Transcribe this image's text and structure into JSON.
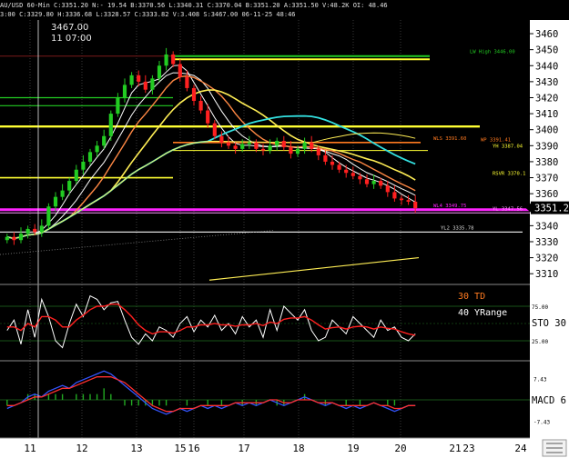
{
  "header": {
    "line1": "AU/USD 60-Min C:3351.20 N:- 19.54 B:3370.56 L:3340.31 C:3370.04 B:3351.20 A:3351.50 V:48.2K OI: 48.46",
    "line2": "3:00 C:3329.80 H:3336.68 L:3328.57 C:3333.82 V:3.408 S:3467.00 06-11-25 48:46"
  },
  "crosshair": {
    "price": "3467.00",
    "time": "11 07:00"
  },
  "colors": {
    "background": "#000000",
    "axis_bg": "#ffffff",
    "price_line": "#ff2020",
    "candle_up": "#22cc22",
    "candle_down": "#ff2020",
    "level_green": "#22cc22",
    "level_yellow": "#ffff33",
    "level_orange": "#ff7a20",
    "level_magenta": "#ff22ff",
    "ma_white": "#ffffff",
    "ma_cyan": "#33e0e0",
    "ma_yellow": "#ffee55",
    "ma_orange": "#ff8844",
    "stoch_white": "#ffffff",
    "stoch_red": "#ff2020",
    "macd_blue": "#3355ff",
    "macd_red": "#ff3030",
    "hist": "#22aa22",
    "divider": "#606060"
  },
  "chart_data": [
    {
      "panel": "price",
      "type": "candlestick",
      "x_labels": [
        "11",
        "12",
        "13",
        "15",
        "16",
        "17",
        "18",
        "19",
        "20",
        "21",
        "23",
        "24"
      ],
      "y_ticks": [
        3310,
        3320,
        3330,
        3340,
        3350,
        3360,
        3370,
        3380,
        3390,
        3400,
        3410,
        3420,
        3430,
        3440,
        3450,
        3460
      ],
      "ylim": [
        3305,
        3464
      ],
      "last_price": "3351.20",
      "closes": [
        3333,
        3331,
        3335,
        3338,
        3336,
        3340,
        3352,
        3358,
        3362,
        3368,
        3375,
        3380,
        3386,
        3390,
        3396,
        3410,
        3420,
        3428,
        3434,
        3430,
        3425,
        3432,
        3440,
        3447,
        3441,
        3433,
        3426,
        3418,
        3412,
        3404,
        3396,
        3392,
        3390,
        3388,
        3391,
        3392,
        3388,
        3387,
        3390,
        3393,
        3389,
        3385,
        3388,
        3392,
        3388,
        3384,
        3380,
        3378,
        3375,
        3373,
        3371,
        3369,
        3366,
        3368,
        3365,
        3361,
        3357,
        3356,
        3355,
        3351
      ],
      "levels": [
        {
          "label": "LW High 3446.00",
          "value": 3446
        },
        {
          "label": "WLS 3391.60",
          "value": 3392
        },
        {
          "label": "WP 3391.41",
          "value": 3391
        },
        {
          "label": "YH 3387.04",
          "value": 3387
        },
        {
          "label": "RSVR 3370.1",
          "value": 3370
        },
        {
          "label": "WL4 3349.75",
          "value": 3350
        },
        {
          "label": "YL 3347.56",
          "value": 3348
        },
        {
          "label": "YL2 3335.78",
          "value": 3336
        }
      ]
    },
    {
      "panel": "stochastic",
      "type": "line",
      "labels": [
        "30 TD",
        "40 YRange"
      ],
      "axis_label": "STO 30",
      "y_ticks": [
        "75.00",
        "25.00"
      ],
      "ylim": [
        0,
        100
      ],
      "series": [
        {
          "values": [
            40,
            55,
            20,
            70,
            30,
            85,
            60,
            25,
            15,
            50,
            78,
            60,
            90,
            85,
            70,
            80,
            82,
            55,
            30,
            20,
            35,
            25,
            45,
            40,
            30,
            50,
            60,
            38,
            55,
            45,
            62,
            40,
            50,
            35,
            60,
            45,
            55,
            30,
            70,
            40,
            75,
            65,
            55,
            70,
            40,
            25,
            30,
            55,
            45,
            35,
            60,
            50,
            40,
            30,
            55,
            40,
            45,
            30,
            25,
            35
          ]
        },
        {
          "values": [
            45,
            45,
            40,
            50,
            45,
            60,
            60,
            55,
            45,
            45,
            55,
            62,
            70,
            75,
            75,
            78,
            78,
            70,
            60,
            48,
            40,
            35,
            38,
            38,
            36,
            40,
            45,
            45,
            48,
            48,
            50,
            48,
            48,
            46,
            48,
            48,
            50,
            47,
            52,
            50,
            56,
            58,
            58,
            60,
            55,
            48,
            42,
            44,
            45,
            42,
            45,
            46,
            45,
            42,
            45,
            43,
            42,
            38,
            35,
            33
          ]
        }
      ]
    },
    {
      "panel": "macd",
      "type": "line",
      "axis_label": "MACD 6",
      "y_ticks": [
        "7.43",
        "-7.43"
      ],
      "ylim": [
        -12,
        12
      ],
      "series": [
        {
          "values": [
            -3,
            -2,
            -1,
            1,
            2,
            1,
            3,
            4,
            5,
            4,
            6,
            7,
            8,
            9,
            10,
            9,
            7,
            5,
            3,
            1,
            -1,
            -3,
            -4,
            -5,
            -4,
            -3,
            -4,
            -3,
            -2,
            -3,
            -2,
            -3,
            -2,
            -1,
            -2,
            -1,
            -2,
            -1,
            0,
            -1,
            -2,
            -1,
            0,
            1,
            0,
            -1,
            -2,
            -1,
            -2,
            -3,
            -2,
            -3,
            -2,
            -1,
            -2,
            -3,
            -4,
            -3,
            -2,
            -2
          ]
        },
        {
          "values": [
            -2,
            -2,
            -1,
            0,
            1,
            1,
            2,
            3,
            4,
            4,
            5,
            6,
            7,
            8,
            8,
            8,
            7,
            6,
            4,
            2,
            0,
            -2,
            -3,
            -4,
            -4,
            -3,
            -3,
            -3,
            -2,
            -2,
            -2,
            -2,
            -2,
            -1,
            -1,
            -1,
            -1,
            -1,
            0,
            0,
            -1,
            -1,
            0,
            0,
            0,
            -1,
            -1,
            -1,
            -2,
            -2,
            -2,
            -2,
            -2,
            -1,
            -2,
            -2,
            -3,
            -3,
            -2,
            -2
          ]
        }
      ]
    }
  ]
}
